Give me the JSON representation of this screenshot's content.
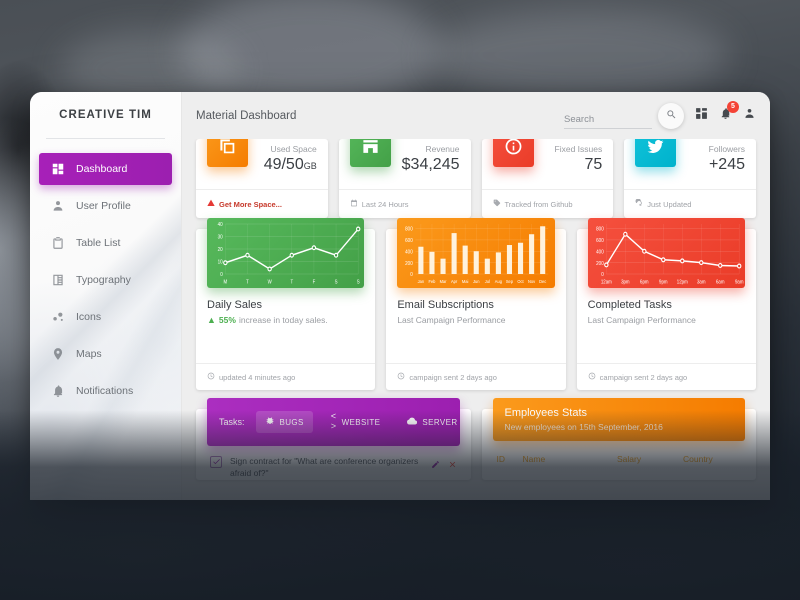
{
  "sidebar": {
    "brand": "CREATIVE TIM",
    "items": [
      {
        "label": "Dashboard",
        "icon": "dashboard-icon",
        "active": true
      },
      {
        "label": "User Profile",
        "icon": "person-icon",
        "active": false
      },
      {
        "label": "Table List",
        "icon": "clipboard-icon",
        "active": false
      },
      {
        "label": "Typography",
        "icon": "typography-icon",
        "active": false
      },
      {
        "label": "Icons",
        "icon": "bubbles-icon",
        "active": false
      },
      {
        "label": "Maps",
        "icon": "map-pin-icon",
        "active": false
      },
      {
        "label": "Notifications",
        "icon": "bell-icon",
        "active": false
      }
    ]
  },
  "header": {
    "title": "Material Dashboard",
    "search_placeholder": "Search",
    "search_value": "",
    "search_icon": "search-icon",
    "dashboard_icon": "grid-icon",
    "notification_icon": "bell-icon",
    "notification_badge": "5",
    "account_icon": "person-icon"
  },
  "stats": [
    {
      "label": "Used Space",
      "value": "49/50",
      "unit": "GB",
      "icon": "copy-icon",
      "color": "#F57C00",
      "color_class": "orange",
      "foot": "Get More Space...",
      "foot_icon": "warning-icon",
      "foot_alert": true
    },
    {
      "label": "Revenue",
      "value": "$34,245",
      "unit": "",
      "icon": "store-icon",
      "color": "#43A047",
      "color_class": "green",
      "foot": "Last 24 Hours",
      "foot_icon": "calendar-icon",
      "foot_alert": false
    },
    {
      "label": "Fixed Issues",
      "value": "75",
      "unit": "",
      "icon": "info-icon",
      "color": "#EA3C28",
      "color_class": "red",
      "foot": "Tracked from Github",
      "foot_icon": "tag-icon",
      "foot_alert": false
    },
    {
      "label": "Followers",
      "value": "+245",
      "unit": "",
      "icon": "twitter-icon",
      "color": "#00B2CC",
      "color_class": "cyan",
      "foot": "Just Updated",
      "foot_icon": "refresh-icon",
      "foot_alert": false
    }
  ],
  "charts": [
    {
      "title": "Daily Sales",
      "subtitle_prefix": "55%",
      "subtitle": "increase in today sales.",
      "foot": "updated 4 minutes ago",
      "foot_icon": "clock-icon",
      "color": "#43A047",
      "color_class": "green"
    },
    {
      "title": "Email Subscriptions",
      "subtitle_prefix": "",
      "subtitle": "Last Campaign Performance",
      "foot": "campaign sent 2 days ago",
      "foot_icon": "clock-icon",
      "color": "#F57C00",
      "color_class": "orange"
    },
    {
      "title": "Completed Tasks",
      "subtitle_prefix": "",
      "subtitle": "Last Campaign Performance",
      "foot": "campaign sent 2 days ago",
      "foot_icon": "clock-icon",
      "color": "#EA3C28",
      "color_class": "red"
    }
  ],
  "chart_data": [
    {
      "type": "line",
      "title": "Daily Sales",
      "categories": [
        "M",
        "T",
        "W",
        "T",
        "F",
        "S",
        "S"
      ],
      "values": [
        9,
        15,
        4,
        15,
        21,
        15,
        36
      ],
      "yticks": [
        0,
        10,
        20,
        30,
        40
      ],
      "ylim": [
        0,
        40
      ],
      "xlabel": "",
      "ylabel": "",
      "grid": true,
      "legend": "none",
      "series_color": "#FFFFFF",
      "plot_bg": "#43A047"
    },
    {
      "type": "bar",
      "title": "Email Subscriptions",
      "categories": [
        "Jan",
        "Feb",
        "Mar",
        "Apr",
        "Mai",
        "Jun",
        "Jul",
        "Aug",
        "Sep",
        "Oct",
        "Nov",
        "Dec"
      ],
      "values": [
        480,
        390,
        270,
        720,
        500,
        400,
        270,
        380,
        510,
        550,
        700,
        840
      ],
      "yticks": [
        0,
        200,
        400,
        600,
        800
      ],
      "ylim": [
        0,
        880
      ],
      "xlabel": "",
      "ylabel": "",
      "grid": true,
      "legend": "none",
      "series_color": "#FFF8E8",
      "plot_bg": "#F57C00"
    },
    {
      "type": "line",
      "title": "Completed Tasks",
      "categories": [
        "12am",
        "3pm",
        "6pm",
        "9pm",
        "12pm",
        "3am",
        "6am",
        "9am"
      ],
      "values": [
        160,
        700,
        400,
        250,
        230,
        200,
        150,
        140
      ],
      "yticks": [
        0,
        200,
        400,
        600,
        800
      ],
      "ylim": [
        0,
        880
      ],
      "xlabel": "",
      "ylabel": "",
      "grid": true,
      "legend": "none",
      "series_color": "#FFFFFF",
      "plot_bg": "#EA3C28"
    }
  ],
  "tasks_card": {
    "label": "Tasks:",
    "tabs": [
      {
        "label": "BUGS",
        "icon": "bug-icon",
        "active": true
      },
      {
        "label": "WEBSITE",
        "icon": "code-icon",
        "active": false
      },
      {
        "label": "SERVER",
        "icon": "cloud-icon",
        "active": false
      }
    ],
    "rows": [
      {
        "text": "Sign contract for \"What are conference organizers afraid of?\"",
        "checked": true,
        "edit_icon": "edit-icon",
        "close_icon": "close-icon"
      }
    ]
  },
  "employees_card": {
    "title": "Employees Stats",
    "subtitle": "New employees on 15th September, 2016",
    "columns": [
      "ID",
      "Name",
      "Salary",
      "Country"
    ]
  }
}
